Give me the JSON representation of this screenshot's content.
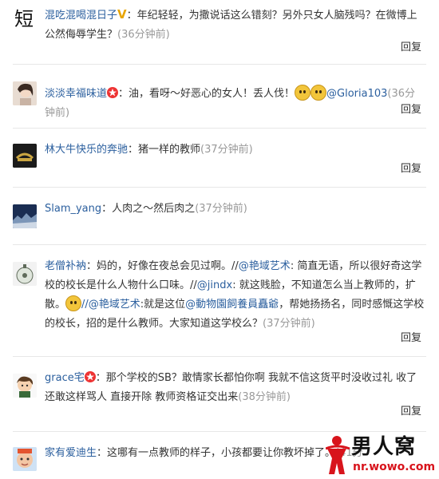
{
  "reply_label": "回复",
  "comments": [
    {
      "user": "混吃混喝混日子",
      "sep": "：",
      "text": "年纪轻轻，为撒说话这么错刻？另外只女人脑残吗？在微博上公然侮辱学生？",
      "time": "(36分钟前)"
    },
    {
      "user": "淡淡幸福味道",
      "sep": "：",
      "text": "油，看呀～好恶心的女人！丢人伐！",
      "mention": "@Gloria103",
      "time": "(36分钟前)"
    },
    {
      "user": "林大牛快乐的奔驰",
      "sep": "：",
      "text": "猪一样的教师",
      "time": "(37分钟前)"
    },
    {
      "user": "Slam_yang",
      "sep": "：",
      "text": "人肉之～然后肉之",
      "time": "(37分钟前)"
    },
    {
      "user": "老僧补衲",
      "sep": "：",
      "text_a": "妈的，好像在夜总会见过啊。//",
      "mention_a": "@艳域艺术",
      "text_b": ": 简直无语，所以很好奇这学校的校长是什么人物什么口味。//",
      "mention_b": "@jindx",
      "text_c": ": 就这贱脸，不知道怎么当上教师的，扩散。",
      "mention_c": "//@艳域艺术",
      "text_d": ":就是这位",
      "mention_d": "@動物園飼養員矗爺",
      "text_e": "，帮她扬扬名，同时感慨这学校的校长，招的是什么教师。大家知道这学校么？",
      "time": "(37分钟前)"
    },
    {
      "user": "grace宅",
      "sep": "：",
      "text": "那个学校的SB？敢情家长都怕你啊 我就不信这货平时没收过礼 收了还敢这样骂人 直接开除 教师资格证交出来",
      "time": "(38分钟前)"
    },
    {
      "user": "家有爱迪生",
      "sep": "：",
      "text": "这哪有一点教师的样子，小孩都要让你教坏掉了。",
      "time": "(41分"
    }
  ],
  "watermark": {
    "title": "男人窝",
    "url": "nr.wowo.com"
  },
  "colors": {
    "link": "#2b5f9e",
    "muted": "#999999",
    "divider": "#e7e7e7",
    "watermark_red": "#d8141c"
  }
}
